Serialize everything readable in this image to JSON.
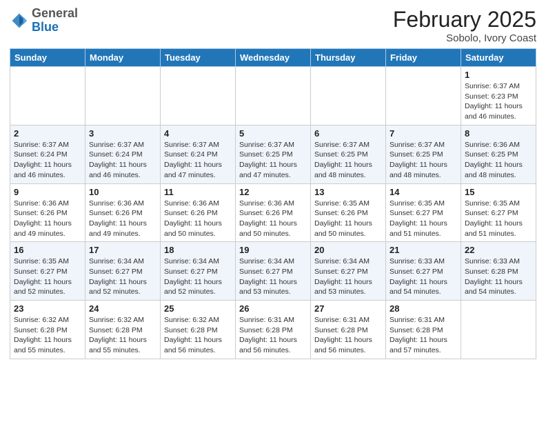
{
  "header": {
    "logo_general": "General",
    "logo_blue": "Blue",
    "title": "February 2025",
    "subtitle": "Sobolo, Ivory Coast"
  },
  "days_of_week": [
    "Sunday",
    "Monday",
    "Tuesday",
    "Wednesday",
    "Thursday",
    "Friday",
    "Saturday"
  ],
  "weeks": [
    [
      {
        "day": "",
        "info": ""
      },
      {
        "day": "",
        "info": ""
      },
      {
        "day": "",
        "info": ""
      },
      {
        "day": "",
        "info": ""
      },
      {
        "day": "",
        "info": ""
      },
      {
        "day": "",
        "info": ""
      },
      {
        "day": "1",
        "info": "Sunrise: 6:37 AM\nSunset: 6:23 PM\nDaylight: 11 hours and 46 minutes."
      }
    ],
    [
      {
        "day": "2",
        "info": "Sunrise: 6:37 AM\nSunset: 6:24 PM\nDaylight: 11 hours and 46 minutes."
      },
      {
        "day": "3",
        "info": "Sunrise: 6:37 AM\nSunset: 6:24 PM\nDaylight: 11 hours and 46 minutes."
      },
      {
        "day": "4",
        "info": "Sunrise: 6:37 AM\nSunset: 6:24 PM\nDaylight: 11 hours and 47 minutes."
      },
      {
        "day": "5",
        "info": "Sunrise: 6:37 AM\nSunset: 6:25 PM\nDaylight: 11 hours and 47 minutes."
      },
      {
        "day": "6",
        "info": "Sunrise: 6:37 AM\nSunset: 6:25 PM\nDaylight: 11 hours and 48 minutes."
      },
      {
        "day": "7",
        "info": "Sunrise: 6:37 AM\nSunset: 6:25 PM\nDaylight: 11 hours and 48 minutes."
      },
      {
        "day": "8",
        "info": "Sunrise: 6:36 AM\nSunset: 6:25 PM\nDaylight: 11 hours and 48 minutes."
      }
    ],
    [
      {
        "day": "9",
        "info": "Sunrise: 6:36 AM\nSunset: 6:26 PM\nDaylight: 11 hours and 49 minutes."
      },
      {
        "day": "10",
        "info": "Sunrise: 6:36 AM\nSunset: 6:26 PM\nDaylight: 11 hours and 49 minutes."
      },
      {
        "day": "11",
        "info": "Sunrise: 6:36 AM\nSunset: 6:26 PM\nDaylight: 11 hours and 50 minutes."
      },
      {
        "day": "12",
        "info": "Sunrise: 6:36 AM\nSunset: 6:26 PM\nDaylight: 11 hours and 50 minutes."
      },
      {
        "day": "13",
        "info": "Sunrise: 6:35 AM\nSunset: 6:26 PM\nDaylight: 11 hours and 50 minutes."
      },
      {
        "day": "14",
        "info": "Sunrise: 6:35 AM\nSunset: 6:27 PM\nDaylight: 11 hours and 51 minutes."
      },
      {
        "day": "15",
        "info": "Sunrise: 6:35 AM\nSunset: 6:27 PM\nDaylight: 11 hours and 51 minutes."
      }
    ],
    [
      {
        "day": "16",
        "info": "Sunrise: 6:35 AM\nSunset: 6:27 PM\nDaylight: 11 hours and 52 minutes."
      },
      {
        "day": "17",
        "info": "Sunrise: 6:34 AM\nSunset: 6:27 PM\nDaylight: 11 hours and 52 minutes."
      },
      {
        "day": "18",
        "info": "Sunrise: 6:34 AM\nSunset: 6:27 PM\nDaylight: 11 hours and 52 minutes."
      },
      {
        "day": "19",
        "info": "Sunrise: 6:34 AM\nSunset: 6:27 PM\nDaylight: 11 hours and 53 minutes."
      },
      {
        "day": "20",
        "info": "Sunrise: 6:34 AM\nSunset: 6:27 PM\nDaylight: 11 hours and 53 minutes."
      },
      {
        "day": "21",
        "info": "Sunrise: 6:33 AM\nSunset: 6:27 PM\nDaylight: 11 hours and 54 minutes."
      },
      {
        "day": "22",
        "info": "Sunrise: 6:33 AM\nSunset: 6:28 PM\nDaylight: 11 hours and 54 minutes."
      }
    ],
    [
      {
        "day": "23",
        "info": "Sunrise: 6:32 AM\nSunset: 6:28 PM\nDaylight: 11 hours and 55 minutes."
      },
      {
        "day": "24",
        "info": "Sunrise: 6:32 AM\nSunset: 6:28 PM\nDaylight: 11 hours and 55 minutes."
      },
      {
        "day": "25",
        "info": "Sunrise: 6:32 AM\nSunset: 6:28 PM\nDaylight: 11 hours and 56 minutes."
      },
      {
        "day": "26",
        "info": "Sunrise: 6:31 AM\nSunset: 6:28 PM\nDaylight: 11 hours and 56 minutes."
      },
      {
        "day": "27",
        "info": "Sunrise: 6:31 AM\nSunset: 6:28 PM\nDaylight: 11 hours and 56 minutes."
      },
      {
        "day": "28",
        "info": "Sunrise: 6:31 AM\nSunset: 6:28 PM\nDaylight: 11 hours and 57 minutes."
      },
      {
        "day": "",
        "info": ""
      }
    ]
  ]
}
